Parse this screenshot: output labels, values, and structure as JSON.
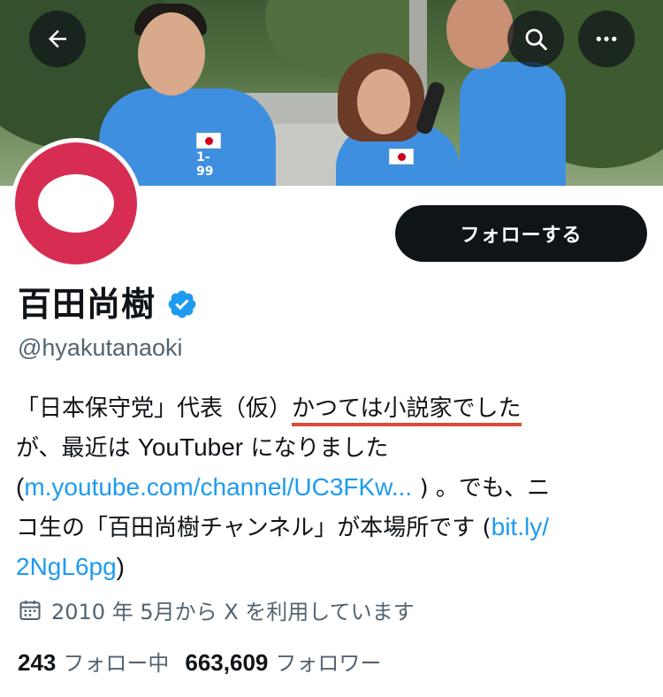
{
  "header": {
    "back_icon": "arrow-left-icon",
    "search_icon": "search-icon",
    "more_icon": "more-horizontal-icon",
    "banner_shirt_text": "1-99"
  },
  "profile": {
    "display_name": "百田尚樹",
    "verified": true,
    "verified_color": "#1d9bf0",
    "handle": "@hyakutanaoki",
    "avatar_color": "#d72d52",
    "follow_button_label": "フォローする"
  },
  "bio": {
    "line1_a": "「日本保守党」代表（仮）",
    "line1_b": "かつては小説家でした",
    "line2_a": "が、最近は ",
    "line2_b": "YouTuber",
    "line2_c": " になりました",
    "line3_open": "(",
    "line3_link": "m.youtube.com/channel/UC3FKw...",
    "line3_rest": " ) 。でも、ニ",
    "line4_text": "コ生の「百田尚樹チャンネル」が本場所です (",
    "line4_link": "bit.ly/",
    "line5_link": "2NgL6pg",
    "line5_close": ")"
  },
  "joined": {
    "icon": "calendar-icon",
    "text": "2010 年 5月から X を利用しています"
  },
  "stats": {
    "following_count": "243",
    "following_label": "フォロー中",
    "followers_count": "663,609",
    "followers_label": "フォロワー"
  }
}
